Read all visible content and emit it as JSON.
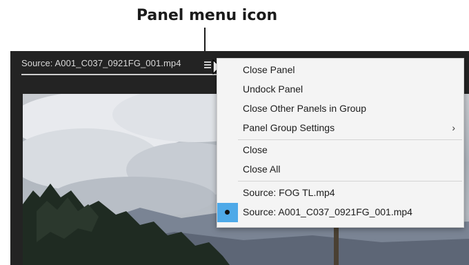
{
  "callout": {
    "title": "Panel menu icon"
  },
  "panel": {
    "tab_label": "Source: A001_C037_0921FG_001.mp4",
    "menu_icon": "hamburger-icon"
  },
  "menu": {
    "items": [
      {
        "label": "Close Panel"
      },
      {
        "label": "Undock Panel"
      },
      {
        "label": "Close Other Panels in Group"
      },
      {
        "label": "Panel Group Settings",
        "submenu_arrow": "›"
      },
      {
        "label": "Close"
      },
      {
        "label": "Close All"
      },
      {
        "label": "Source: FOG TL.mp4"
      },
      {
        "label": "Source: A001_C037_0921FG_001.mp4",
        "selected": true
      }
    ]
  },
  "colors": {
    "panel_bg": "#232323",
    "menu_bg": "#f4f4f4",
    "selection_accent": "#4ea9e8"
  }
}
